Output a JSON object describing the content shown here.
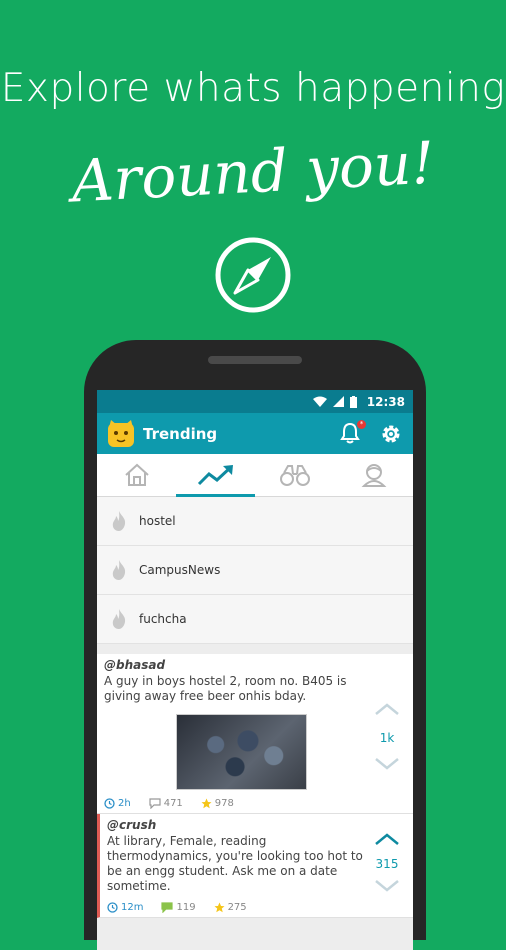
{
  "promo": {
    "headline": "Explore whats happening",
    "script_text": "Around you!"
  },
  "status_bar": {
    "time": "12:38"
  },
  "app_bar": {
    "title": "Trending",
    "notification_badge": "*"
  },
  "tabs": [
    {
      "name": "home",
      "icon": "home-icon",
      "active": false
    },
    {
      "name": "trending",
      "icon": "trending-icon",
      "active": true
    },
    {
      "name": "explore",
      "icon": "binoculars-icon",
      "active": false
    },
    {
      "name": "profile",
      "icon": "profile-icon",
      "active": false
    }
  ],
  "topics": [
    {
      "label": "hostel"
    },
    {
      "label": "CampusNews"
    },
    {
      "label": "fuchcha"
    }
  ],
  "posts": [
    {
      "author": "@bhasad",
      "text": "A guy in boys hostel 2, room no. B405 is giving away free beer onhis bday.",
      "has_photo": true,
      "votes": "1k",
      "time": "2h",
      "comments": "471",
      "stars": "978"
    },
    {
      "author": "@crush",
      "text": "At library, Female, reading thermodynamics, you're looking too hot to be an engg student. Ask me on a date sometime.",
      "has_photo": false,
      "votes": "315",
      "time": "12m",
      "comments": "119",
      "stars": "275"
    }
  ],
  "colors": {
    "background": "#13aa60",
    "app_bar": "#0e9aad",
    "status_bar": "#0a7c8f",
    "accent": "#0e9aad"
  }
}
